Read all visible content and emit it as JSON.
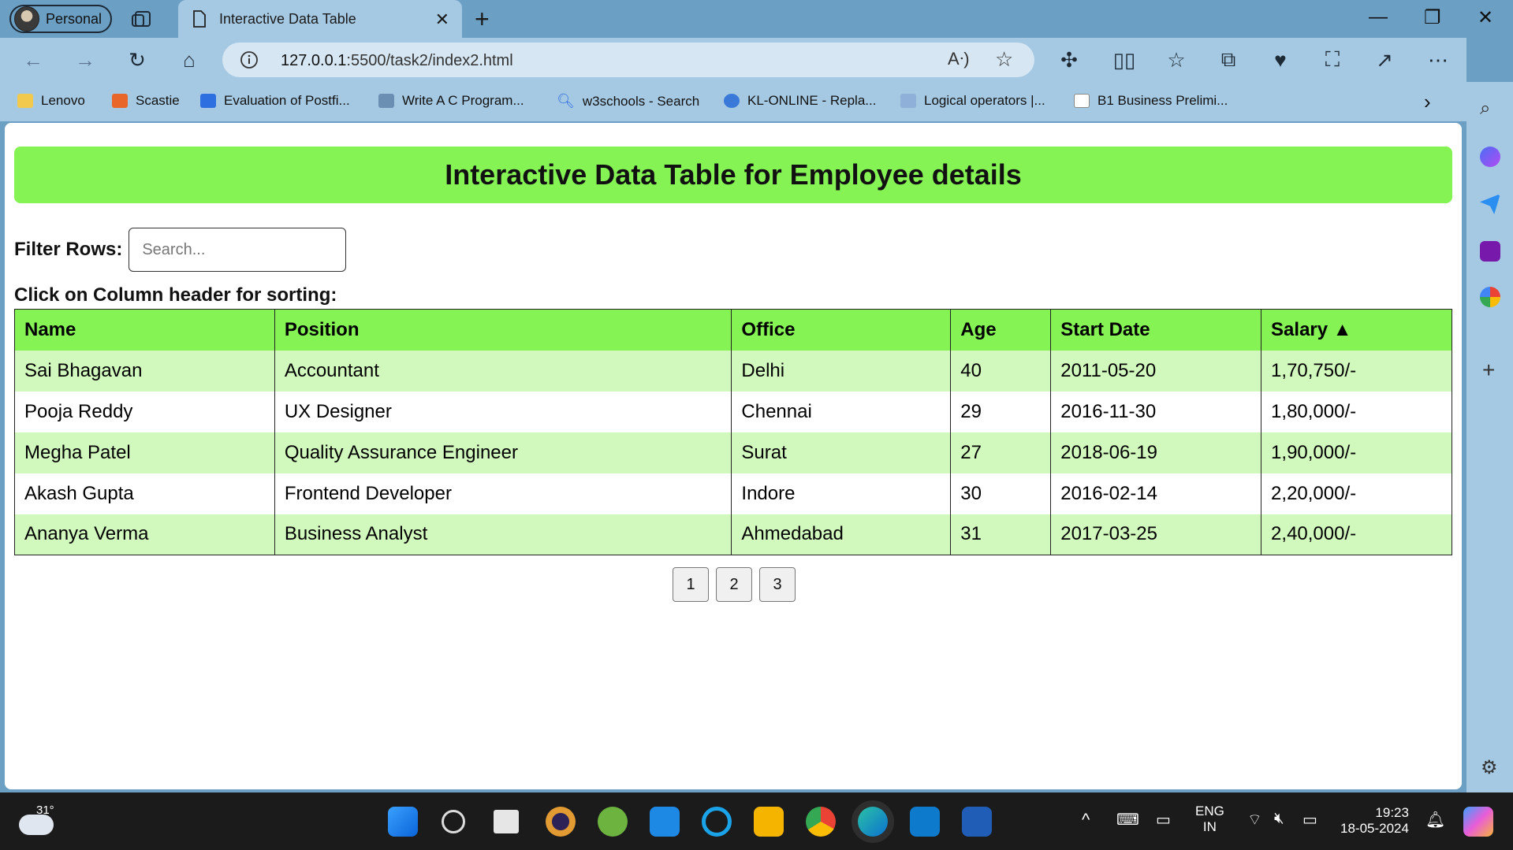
{
  "browser": {
    "profile_label": "Personal",
    "tab_title": "Interactive Data Table",
    "url_host": "127.0.0.1",
    "url_path": ":5500/task2/index2.html"
  },
  "bookmarks": [
    {
      "label": "Lenovo",
      "color": "#f2c94c"
    },
    {
      "label": "Scastie",
      "color": "#e8662a"
    },
    {
      "label": "Evaluation of Postfi...",
      "color": "#2d6ee0"
    },
    {
      "label": "Write A C Program...",
      "color": "#6b8fb3"
    },
    {
      "label": "w3schools - Search",
      "color": "#2d6ee0"
    },
    {
      "label": "KL-ONLINE - Repla...",
      "color": "#3b79d8"
    },
    {
      "label": "Logical operators |...",
      "color": "#8fb0d8"
    },
    {
      "label": "B1 Business Prelimi...",
      "color": "#ffffff"
    }
  ],
  "page": {
    "heading": "Interactive Data Table for Employee details",
    "filter_label": "Filter Rows:",
    "search_placeholder": "Search...",
    "sort_hint": "Click on Column header for sorting:",
    "columns": [
      "Name",
      "Position",
      "Office",
      "Age",
      "Start Date",
      "Salary ▲"
    ],
    "rows": [
      [
        "Sai Bhagavan",
        "Accountant",
        "Delhi",
        "40",
        "2011-05-20",
        "1,70,750/-"
      ],
      [
        "Pooja Reddy",
        "UX Designer",
        "Chennai",
        "29",
        "2016-11-30",
        "1,80,000/-"
      ],
      [
        "Megha Patel",
        "Quality Assurance Engineer",
        "Surat",
        "27",
        "2018-06-19",
        "1,90,000/-"
      ],
      [
        "Akash Gupta",
        "Frontend Developer",
        "Indore",
        "30",
        "2016-02-14",
        "2,20,000/-"
      ],
      [
        "Ananya Verma",
        "Business Analyst",
        "Ahmedabad",
        "31",
        "2017-03-25",
        "2,40,000/-"
      ]
    ],
    "pages": [
      "1",
      "2",
      "3"
    ]
  },
  "taskbar": {
    "weather": "31°",
    "lang_top": "ENG",
    "lang_bottom": "IN",
    "time": "19:23",
    "date": "18-05-2024"
  },
  "colors": {
    "header_green": "#86f355",
    "row_green": "#d1f8bd",
    "chrome_blue": "#a6c9e3"
  }
}
